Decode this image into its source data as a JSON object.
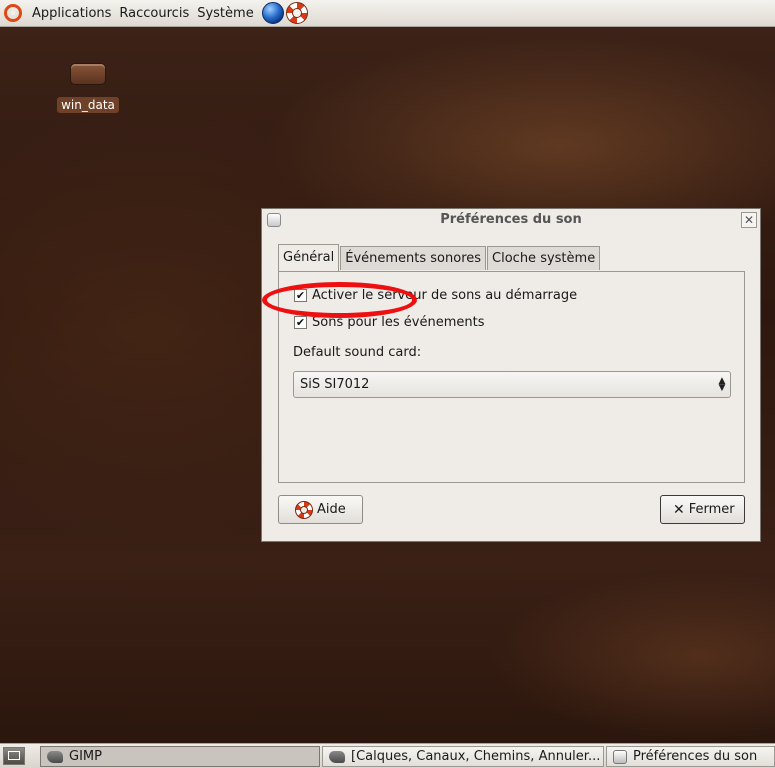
{
  "top_panel": {
    "menus": [
      "Applications",
      "Raccourcis",
      "Système"
    ],
    "launchers": [
      "web-browser-icon",
      "help-icon"
    ]
  },
  "desktop": {
    "icons": [
      {
        "label": "win_data",
        "icon": "drive-icon"
      }
    ]
  },
  "dialog": {
    "title": "Préférences du son",
    "tabs": [
      "Général",
      "Événements sonores",
      "Cloche système"
    ],
    "active_tab": "Général",
    "checkboxes": [
      {
        "label": "Activer le serveur de sons au démarrage",
        "checked": true
      },
      {
        "label": "Sons pour les événements",
        "checked": true
      }
    ],
    "sound_card_label": "Default sound card:",
    "sound_card_value": "SiS SI7012",
    "help_button": "Aide",
    "close_button": "Fermer",
    "annotation_color": "#ee1010"
  },
  "taskbar": {
    "tasks": [
      {
        "label": "GIMP",
        "icon": "gimp-icon",
        "active": true
      },
      {
        "label": "[Calques, Canaux, Chemins, Annuler...",
        "icon": "gimp-icon",
        "active": false
      },
      {
        "label": "Préférences du son",
        "icon": "sound-prefs-icon",
        "active": false
      }
    ]
  }
}
